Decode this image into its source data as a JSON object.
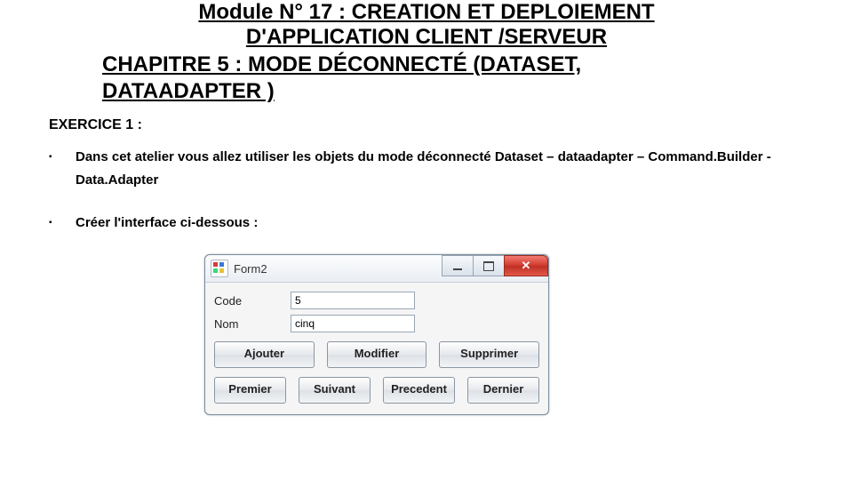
{
  "header": {
    "module_line1": "Module N° 17 : CREATION ET DEPLOIEMENT",
    "module_line2": "D'APPLICATION CLIENT /SERVEUR",
    "chapter_prefix": "CHAPITRE 5 : ",
    "chapter_rest": "MODE DÉCONNECTÉ (DATASET, DATAADAPTER )"
  },
  "exercice_label": "EXERCICE 1 :",
  "paragraphs": {
    "p1": "Dans cet atelier vous allez utiliser les objets du mode déconnecté  Dataset – dataadapter – Command.Builder -Data.Adapter",
    "p2": "Créer l'interface ci-dessous :"
  },
  "form": {
    "title": "Form2",
    "code_label": "Code",
    "code_value": "5",
    "nom_label": "Nom",
    "nom_value": "cinq",
    "buttons": {
      "ajouter": "Ajouter",
      "modifier": "Modifier",
      "supprimer": "Supprimer",
      "premier": "Premier",
      "suivant": "Suivant",
      "precedent": "Precedent",
      "dernier": "Dernier"
    }
  }
}
